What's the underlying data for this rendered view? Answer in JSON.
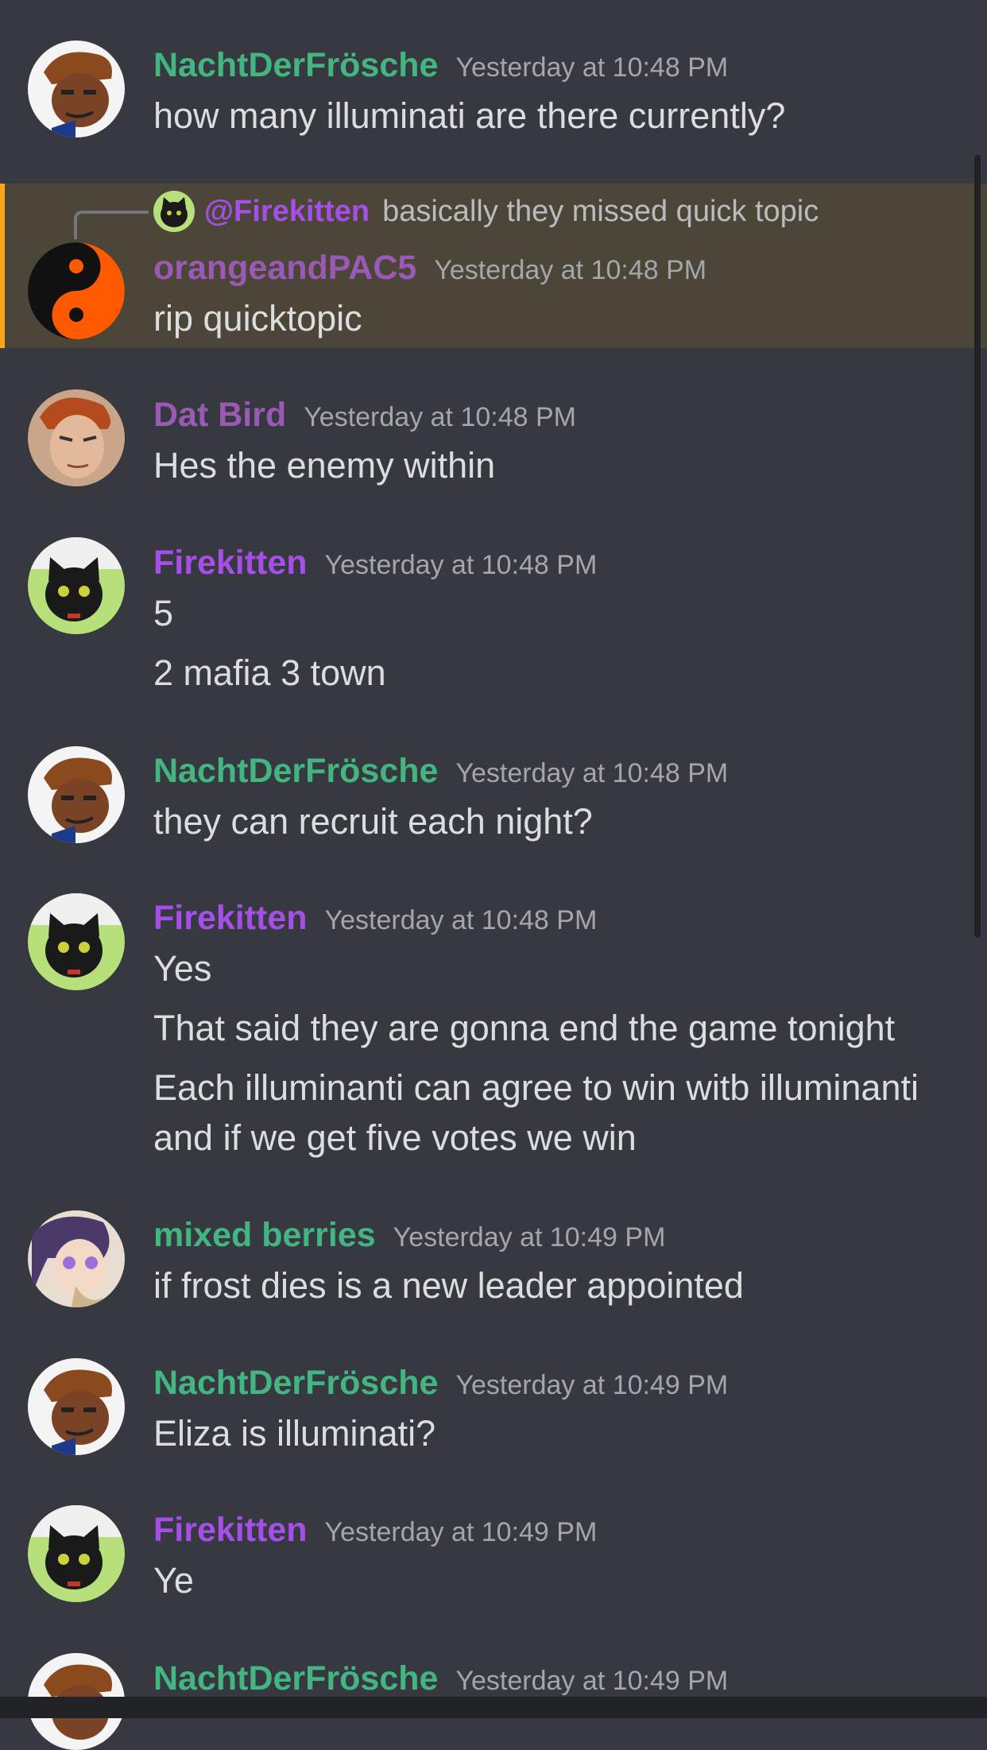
{
  "reply": {
    "mention": "@Firekitten",
    "text": "basically they missed quick topic"
  },
  "messages": [
    {
      "user": "NachtDerFrösche",
      "time": "Yesterday at 10:48 PM",
      "lines": [
        "how many illuminati are there currently?"
      ]
    },
    {
      "user": "orangeandPAC5",
      "time": "Yesterday at 10:48 PM",
      "lines": [
        "rip quicktopic"
      ]
    },
    {
      "user": "Dat Bird",
      "time": "Yesterday at 10:48 PM",
      "lines": [
        "Hes the enemy within"
      ]
    },
    {
      "user": "Firekitten",
      "time": "Yesterday at 10:48 PM",
      "lines": [
        "5",
        "2 mafia 3 town"
      ]
    },
    {
      "user": "NachtDerFrösche",
      "time": "Yesterday at 10:48 PM",
      "lines": [
        "they can recruit each night?"
      ]
    },
    {
      "user": "Firekitten",
      "time": "Yesterday at 10:48 PM",
      "lines": [
        "Yes",
        "That said they are gonna end the game tonight",
        "Each illuminanti can agree to win witb illuminanti",
        "and if we get five votes we win"
      ]
    },
    {
      "user": "mixed berries",
      "time": "Yesterday at 10:49 PM",
      "lines": [
        "if frost dies is a new leader appointed"
      ]
    },
    {
      "user": "NachtDerFrösche",
      "time": "Yesterday at 10:49 PM",
      "lines": [
        "Eliza is illuminati?"
      ]
    },
    {
      "user": "Firekitten",
      "time": "Yesterday at 10:49 PM",
      "lines": [
        "Ye"
      ]
    },
    {
      "user": "NachtDerFrösche",
      "time": "Yesterday at 10:49 PM",
      "lines": []
    }
  ],
  "colors": {
    "background": "#36393f",
    "highlight": "#4b4637",
    "highlight_bar": "#faa61a",
    "green_user": "#43b581",
    "purple_user": "#9b59b6",
    "violet_user": "#a64ee8"
  }
}
